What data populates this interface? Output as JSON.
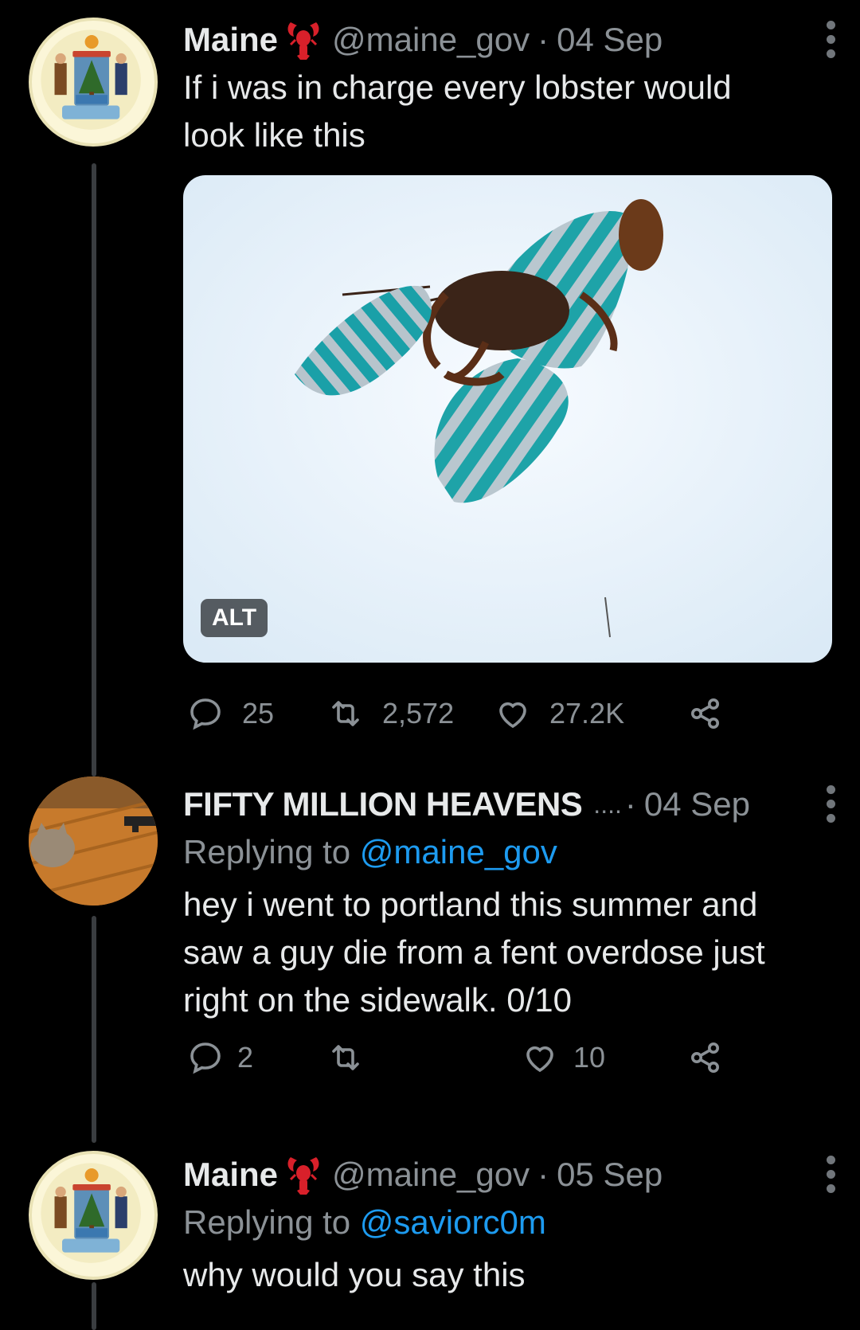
{
  "tweets": [
    {
      "name": "Maine",
      "badge_icon": "lobster-emoji-icon",
      "handle": "@maine_gov",
      "separator": "·",
      "time": "04 Sep",
      "text": "If i was in charge every lobster would look like this",
      "media": {
        "alt_label": "ALT"
      },
      "replies": "25",
      "retweets": "2,572",
      "likes": "27.2K"
    },
    {
      "name": "FIFTY MILLION HEAVENS",
      "name_ellipsis": "....",
      "handle": "",
      "separator": "·",
      "time": "04 Sep",
      "reply_prefix": "Replying to",
      "reply_mention": "@maine_gov",
      "text": "hey i went to portland this summer and saw a guy die from a fent overdose just right on the sidewalk. 0/10",
      "replies": "2",
      "retweets": "",
      "likes": "10"
    },
    {
      "name": "Maine",
      "badge_icon": "lobster-emoji-icon",
      "handle": "@maine_gov",
      "separator": "·",
      "time": "05 Sep",
      "reply_prefix": "Replying to",
      "reply_mention": "@saviorc0m",
      "text": "why would you say this"
    }
  ],
  "colors": {
    "background": "#000000",
    "text": "#e7e9ea",
    "muted": "#8b9196",
    "link": "#1d9bf0",
    "thread_line": "#3a3d40"
  }
}
